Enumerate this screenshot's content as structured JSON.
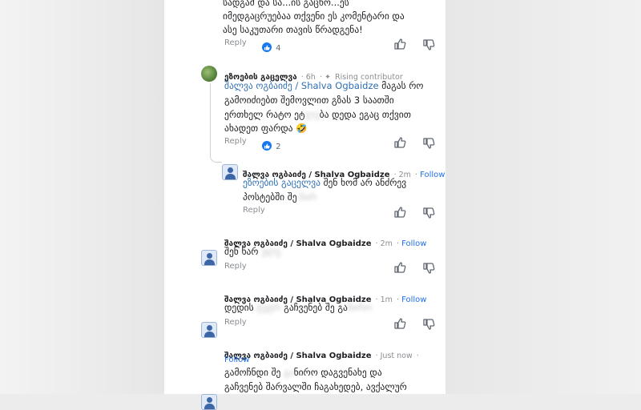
{
  "comments": [
    {
      "lines": [
        "სადგამ და სა...ის გაცხო...ეს",
        "იმედგაცრუებაა თქვენი ეს კომენტარი და",
        "ასე საკუთარი თავის წრადგენა!"
      ],
      "reply": "Reply",
      "likes": "4"
    },
    {
      "author": "ეზოების გაცელვა",
      "time": "6h",
      "badge": "Rising contributor",
      "mention": "შალვა ოგბაიძე / Shalva Ogbaidze",
      "line1_rest": " მაგას რო",
      "lines": [
        "გამოიძიებთ შემოვლით გზას 3 საათში",
        "ერთხელ რატო ეტ",
        "ახადეთ ფარდა 🤣"
      ],
      "blur_a": "ლე",
      "line3_tail": "ბა დედა ეგაც თქვით",
      "reply": "Reply",
      "likes": "2"
    },
    {
      "author": "შალვა ოგბაიძე / Shalva Ogbaidze",
      "time": "2m",
      "follow": "Follow",
      "mention": "ეზოების გაცელვა",
      "line1_rest": " შენ ხომ არ ანძრევ",
      "line2": "პოსტებში შე",
      "blur": "ნირ",
      "reply": "Reply"
    },
    {
      "author": "შალვა ოგბაიძე / Shalva Ogbaidze",
      "time": "2m",
      "follow": "Follow",
      "line_a": "შენ ხარ",
      "blur": "ულე",
      "reply": "Reply"
    },
    {
      "author": "შალვა ოგბაიძე / Shalva Ogbaidze",
      "time": "1m",
      "follow": "Follow",
      "line_a": "დედის",
      "blur_a": "ტუტრ",
      "line_b": " გაჩვენებ შე გა",
      "blur_b": "ნირო",
      "reply": "Reply"
    },
    {
      "author": "შალვა ოგბაიძე / Shalva Ogbaidze",
      "time": "Just now",
      "follow": "Follow",
      "line1_a": "გამოჩნდი შე ",
      "blur": "გა",
      "line1_b": "ნირო დაგვენახე და",
      "line2": "გაჩვენებ შარვალში ჩაგახედებ, ავქალურ"
    }
  ]
}
